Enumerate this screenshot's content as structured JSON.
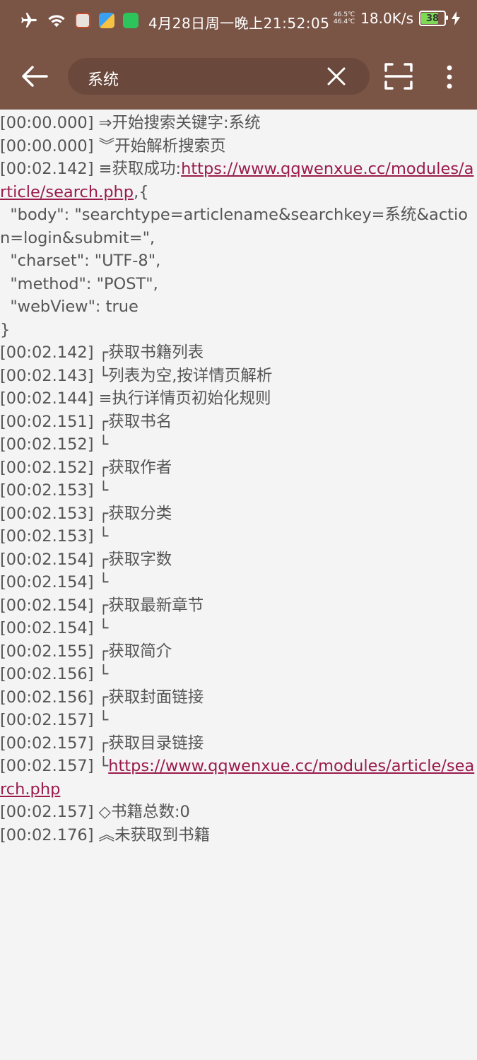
{
  "status_bar": {
    "clock": "4月28日周一晚上21:52:05",
    "temp_top": "46.5℃",
    "temp_bottom": "46.4℃",
    "net_speed": "18.0K/s",
    "battery": "38"
  },
  "toolbar": {
    "search_value": "系统"
  },
  "log": [
    {
      "time": "[00:00.000]",
      "msg": " ⇒开始搜索关键字:系统"
    },
    {
      "time": "[00:00.000]",
      "msg": " ︾开始解析搜索页"
    },
    {
      "time": "[00:02.142]",
      "msg": " ≡获取成功:",
      "link": "https://www.qqwenxue.cc/modules/article/search.php",
      "after": ",{"
    },
    {
      "msg": "  \"body\": \"searchtype=articlename&searchkey=系统&action=login&submit=\","
    },
    {
      "msg": "  \"charset\": \"UTF-8\","
    },
    {
      "msg": "  \"method\": \"POST\","
    },
    {
      "msg": "  \"webView\": true"
    },
    {
      "msg": "}"
    },
    {
      "time": "[00:02.142]",
      "msg": " ┌获取书籍列表"
    },
    {
      "time": "[00:02.143]",
      "msg": " └列表为空,按详情页解析"
    },
    {
      "time": "[00:02.144]",
      "msg": " ≡执行详情页初始化规则"
    },
    {
      "time": "[00:02.151]",
      "msg": " ┌获取书名"
    },
    {
      "time": "[00:02.152]",
      "msg": " └"
    },
    {
      "time": "[00:02.152]",
      "msg": " ┌获取作者"
    },
    {
      "time": "[00:02.153]",
      "msg": " └"
    },
    {
      "time": "[00:02.153]",
      "msg": " ┌获取分类"
    },
    {
      "time": "[00:02.153]",
      "msg": " └"
    },
    {
      "time": "[00:02.154]",
      "msg": " ┌获取字数"
    },
    {
      "time": "[00:02.154]",
      "msg": " └"
    },
    {
      "time": "[00:02.154]",
      "msg": " ┌获取最新章节"
    },
    {
      "time": "[00:02.154]",
      "msg": " └"
    },
    {
      "time": "[00:02.155]",
      "msg": " ┌获取简介"
    },
    {
      "time": "[00:02.156]",
      "msg": " └"
    },
    {
      "time": "[00:02.156]",
      "msg": " ┌获取封面链接"
    },
    {
      "time": "[00:02.157]",
      "msg": " └"
    },
    {
      "time": "[00:02.157]",
      "msg": " ┌获取目录链接"
    },
    {
      "time": "[00:02.157]",
      "msg": " └",
      "link": "https://www.qqwenxue.cc/modules/article/search.php"
    },
    {
      "time": "[00:02.157]",
      "msg": " ◇书籍总数:0"
    },
    {
      "time": "[00:02.176]",
      "msg": " ︽未获取到书籍"
    }
  ]
}
